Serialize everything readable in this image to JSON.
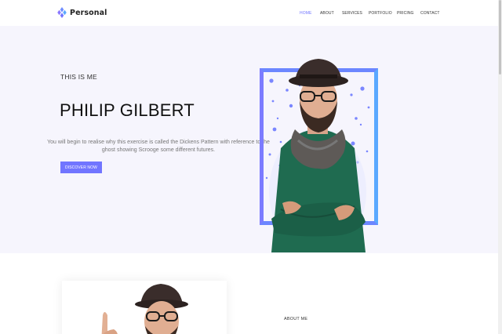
{
  "brand": {
    "name": "Personal",
    "logo_icon": "diamond-cluster-icon",
    "accent": "#7175ff"
  },
  "nav": {
    "items": [
      {
        "label": "HOME",
        "active": true
      },
      {
        "label": "ABOUT",
        "active": false
      },
      {
        "label": "SERVICES",
        "active": false
      },
      {
        "label": "PORTFOLIO",
        "active": false
      },
      {
        "label": "PRICING",
        "active": false
      },
      {
        "label": "CONTACT",
        "active": false
      }
    ]
  },
  "hero": {
    "eyebrow": "THIS IS ME",
    "title": "PHILIP GILBERT",
    "description": "You will begin to realise why this exercise is called the Dickens Pattern with reference to the ghost showing Scrooge some different futures.",
    "cta_label": "DISCOVER NOW",
    "frame_color": "#6c86ff",
    "background": "#f6f5fd"
  },
  "about": {
    "label": "ABOUT ME"
  }
}
